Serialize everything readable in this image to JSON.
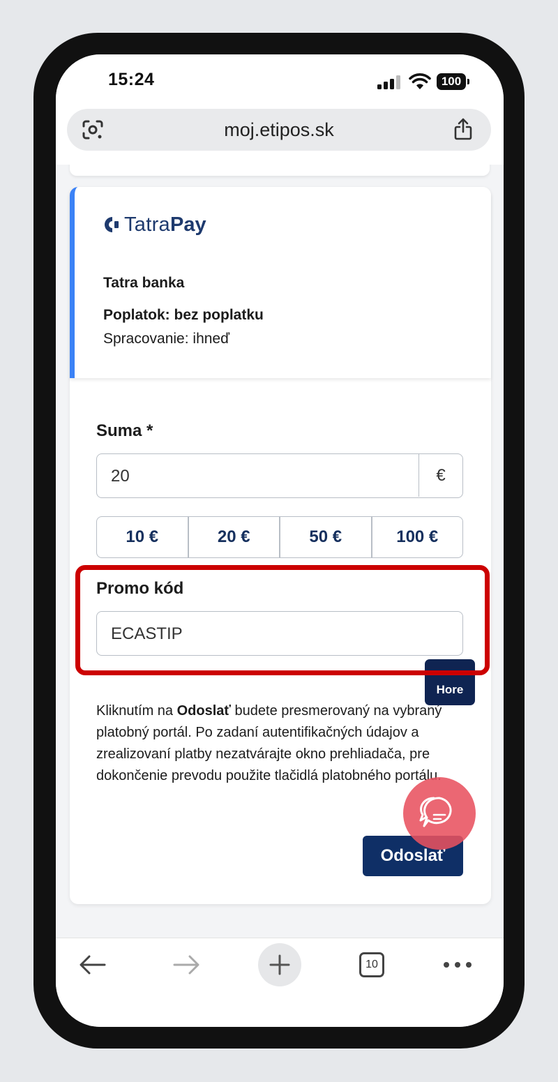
{
  "status_bar": {
    "time": "15:24",
    "battery": "100"
  },
  "browser": {
    "url": "moj.etipos.sk",
    "tab_count": "10"
  },
  "payment_method": {
    "logo_tatra": "Tatra",
    "logo_pay": "Pay",
    "bank": "Tatra banka",
    "fee": "Poplatok: bez poplatku",
    "processing": "Spracovanie: ihneď"
  },
  "form": {
    "amount_label": "Suma *",
    "amount_value": "20",
    "currency": "€",
    "presets": [
      "10 €",
      "20 €",
      "50 €",
      "100 €"
    ],
    "promo_label": "Promo kód",
    "promo_value": "ECASTIP",
    "notice_prefix": "Kliknutím na ",
    "notice_bold": "Odoslať",
    "notice_suffix": " budete presmerovaný na vybraný platobný portál. Po zadaní autentifikačných údajov a zrealizovaní platby nezatvárajte okno prehliadača, pre dokončenie prevodu použite tlačidlá platobného portálu.",
    "submit_label": "Odoslať"
  },
  "scroll_top_label": "Hore",
  "colors": {
    "accent_blue": "#3b82f6",
    "navy": "#0f2f66",
    "highlight_red": "#cc0000",
    "chat_bubble": "#e85260"
  }
}
